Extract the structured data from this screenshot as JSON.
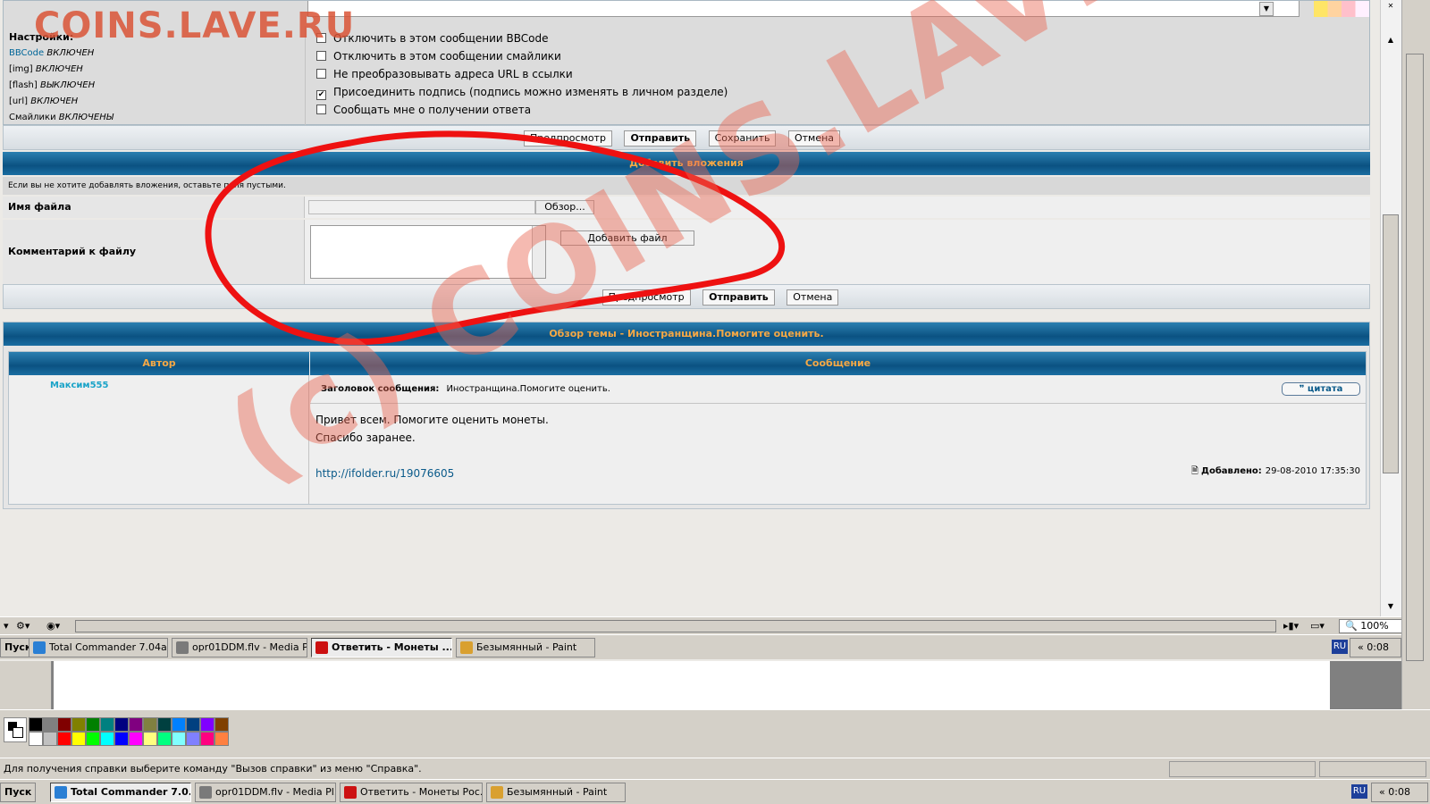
{
  "logo": "COINS.LAVE.RU",
  "watermark": "(c) COINS.LAVE.RU",
  "settings": {
    "title": "Настройки:",
    "lines": [
      {
        "label": "BBCode",
        "state": "ВКЛЮЧЕН"
      },
      {
        "label": "[img]",
        "state": "ВКЛЮЧЕН"
      },
      {
        "label": "[flash]",
        "state": "ВЫКЛЮЧЕН"
      },
      {
        "label": "[url]",
        "state": "ВКЛЮЧЕН"
      },
      {
        "label": "Смайлики",
        "state": "ВКЛЮЧЕНЫ"
      }
    ],
    "options": [
      {
        "label": "Отключить в этом сообщении BBCode",
        "checked": false
      },
      {
        "label": "Отключить в этом сообщении смайлики",
        "checked": false
      },
      {
        "label": "Не преобразовывать адреса URL в ссылки",
        "checked": false
      },
      {
        "label": "Присоединить подпись (подпись можно изменять в личном разделе)",
        "checked": true
      },
      {
        "label": "Сообщать мне о получении ответа",
        "checked": false
      }
    ]
  },
  "post_buttons": {
    "preview": "Предпросмотр",
    "submit": "Отправить",
    "save": "Сохранить",
    "cancel": "Отмена"
  },
  "attachments": {
    "header": "Добавить вложения",
    "hint": "Если вы не хотите добавлять вложения, оставьте поля пустыми.",
    "filename_label": "Имя файла",
    "browse": "Обзор...",
    "comment_label": "Комментарий к файлу",
    "add_file": "Добавить файл"
  },
  "attach_buttons": {
    "preview": "Предпросмотр",
    "submit": "Отправить",
    "cancel": "Отмена"
  },
  "topic_review": {
    "header": "Обзор темы - Иностранщина.Помогите оценить.",
    "col_author": "Автор",
    "col_message": "Сообщение",
    "author": "Максим555",
    "subject_label": "Заголовок сообщения:",
    "subject": "Иностранщина.Помогите оценить.",
    "quote": "цитата",
    "body_line1": "Привет всем. Помогите оценить монеты.",
    "body_line2": "Спасибо заранее.",
    "link": "http://ifolder.ru/19076605",
    "added_label": "Добавлено:",
    "added_date": "29-08-2010 17:35:30"
  },
  "browser_status": {
    "zoom": "100%"
  },
  "taskbar_inner": {
    "start": "Пуск",
    "tasks": [
      {
        "label": "Total Commander 7.04a ...",
        "color": "#2a7fd4",
        "active": false
      },
      {
        "label": "opr01DDM.flv - Media Pl...",
        "color": "#7a7a7a",
        "active": false
      },
      {
        "label": "Ответить - Монеты ...",
        "color": "#cc1111",
        "active": true
      },
      {
        "label": "Безымянный - Paint",
        "color": "#d9a030",
        "active": false
      }
    ],
    "lang": "RU",
    "clock": "0:08"
  },
  "palette": {
    "colors": [
      "#000000",
      "#808080",
      "#800000",
      "#808000",
      "#008000",
      "#008080",
      "#000080",
      "#800080",
      "#808040",
      "#004040",
      "#0080ff",
      "#004080",
      "#8000ff",
      "#804000",
      "#ffffff",
      "#c0c0c0",
      "#ff0000",
      "#ffff00",
      "#00ff00",
      "#00ffff",
      "#0000ff",
      "#ff00ff",
      "#ffff80",
      "#00ff80",
      "#80ffff",
      "#8080ff",
      "#ff0080",
      "#ff8040"
    ]
  },
  "paint_status": {
    "help": "Для получения справки выберите команду \"Вызов справки\" из меню \"Справка\"."
  },
  "taskbar_outer": {
    "start": "Пуск",
    "tasks": [
      {
        "label": "Total Commander 7.0...",
        "color": "#2a7fd4",
        "active": true
      },
      {
        "label": "opr01DDM.flv - Media Pl...",
        "color": "#7a7a7a",
        "active": false
      },
      {
        "label": "Ответить - Монеты Рос...",
        "color": "#cc1111",
        "active": false
      },
      {
        "label": "Безымянный - Paint",
        "color": "#d9a030",
        "active": false
      }
    ],
    "lang": "RU",
    "clock": "0:08"
  }
}
